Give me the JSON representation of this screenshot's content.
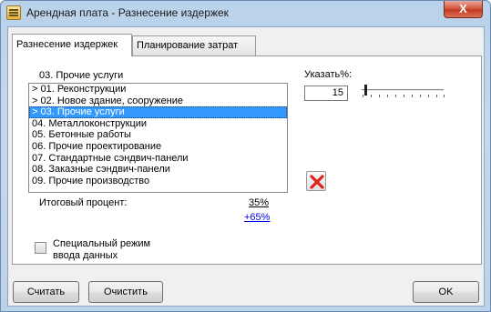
{
  "window": {
    "title": "Арендная плата - Разнесение издержек",
    "close_glyph": "X"
  },
  "tabs": [
    {
      "label": "Разнесение издержек",
      "active": true
    },
    {
      "label": "Планирование затрат",
      "active": false
    }
  ],
  "category_header": "03. Прочие услуги",
  "list": {
    "items": [
      {
        "label": "> 01. Реконструкции",
        "selected": false
      },
      {
        "label": "> 02. Новое здание, сооружение",
        "selected": false
      },
      {
        "label": "> 03. Прочие услуги",
        "selected": true
      },
      {
        "label": "04. Металлоконструкции",
        "selected": false
      },
      {
        "label": "05. Бетонные работы",
        "selected": false
      },
      {
        "label": "06. Прочие проектирование",
        "selected": false
      },
      {
        "label": "07. Стандартные сэндвич-панели",
        "selected": false
      },
      {
        "label": "08. Заказные сэндвич-панели",
        "selected": false
      },
      {
        "label": "09. Прочие производство",
        "selected": false
      }
    ]
  },
  "percent": {
    "label": "Указать%:",
    "value": "15",
    "slider_fraction": 0.15
  },
  "totals": {
    "label": "Итоговый процент:",
    "value": "35%",
    "link_value": "+65%"
  },
  "special_mode": {
    "line1": "Специальный режим",
    "line2": "ввода данных",
    "checked": false
  },
  "buttons": {
    "calculate": "Считать",
    "clear": "Очистить",
    "ok": "OK"
  },
  "colors": {
    "selection": "#3399ff",
    "delete_icon": "#e0221c",
    "link": "#0000ee"
  },
  "icons": {
    "delete": "red-x-icon",
    "app": "form-icon"
  }
}
